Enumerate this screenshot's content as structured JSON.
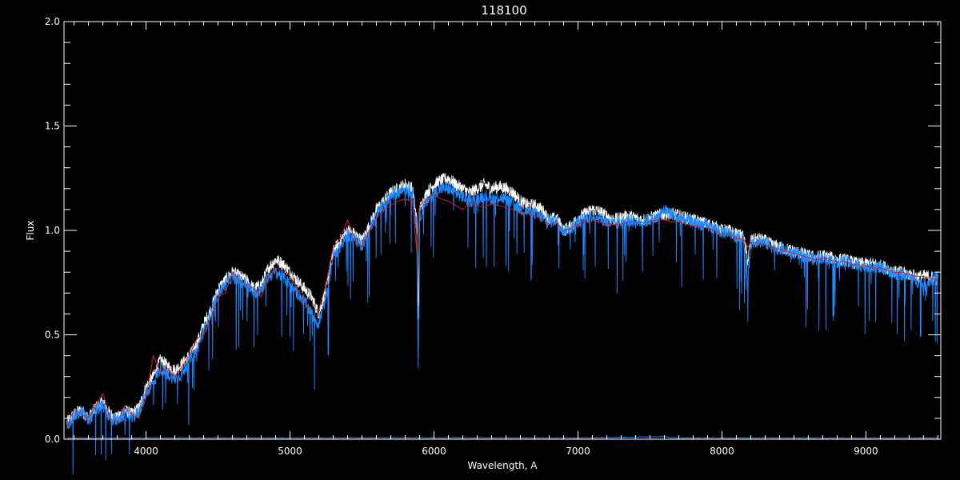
{
  "chart_data": {
    "type": "line",
    "title": "118100",
    "xlabel": "Wavelength, A",
    "ylabel": "Flux",
    "xlim": [
      3430,
      9520
    ],
    "ylim": [
      0.0,
      2.0
    ],
    "x_ticks": [
      4000,
      5000,
      6000,
      7000,
      8000,
      9000
    ],
    "x_tick_labels": [
      "4000",
      "5000",
      "6000",
      "7000",
      "8000",
      "9000"
    ],
    "y_ticks": [
      0.0,
      0.5,
      1.0,
      1.5,
      2.0
    ],
    "y_tick_labels": [
      "0.0",
      "0.5",
      "1.0",
      "1.5",
      "2.0"
    ],
    "grid": false,
    "background": "#000000",
    "series": [
      {
        "style": "white-spectrum",
        "color": "#ffffff",
        "x": [
          3450,
          3500,
          3550,
          3600,
          3650,
          3700,
          3750,
          3800,
          3850,
          3900,
          3950,
          4000,
          4050,
          4100,
          4150,
          4200,
          4250,
          4300,
          4350,
          4400,
          4450,
          4500,
          4550,
          4600,
          4650,
          4700,
          4750,
          4800,
          4850,
          4900,
          4950,
          5000,
          5050,
          5100,
          5150,
          5200,
          5250,
          5300,
          5350,
          5400,
          5450,
          5500,
          5550,
          5600,
          5650,
          5700,
          5750,
          5800,
          5850,
          5880,
          5890,
          5900,
          5950,
          6000,
          6050,
          6100,
          6150,
          6200,
          6250,
          6300,
          6350,
          6400,
          6450,
          6500,
          6550,
          6600,
          6650,
          6700,
          6750,
          6800,
          6850,
          6900,
          6950,
          7000,
          7050,
          7100,
          7150,
          7200,
          7250,
          7300,
          7350,
          7400,
          7450,
          7500,
          7550,
          7600,
          7650,
          7700,
          7750,
          7800,
          7850,
          7900,
          7950,
          8000,
          8050,
          8100,
          8150,
          8180,
          8200,
          8250,
          8300,
          8350,
          8400,
          8450,
          8500,
          8550,
          8600,
          8650,
          8700,
          8750,
          8800,
          8850,
          8900,
          8950,
          9000,
          9050,
          9100,
          9150,
          9200,
          9250,
          9300,
          9350,
          9400,
          9450,
          9500
        ],
        "y": [
          0.08,
          0.12,
          0.14,
          0.1,
          0.15,
          0.18,
          0.12,
          0.1,
          0.14,
          0.12,
          0.15,
          0.25,
          0.3,
          0.38,
          0.35,
          0.33,
          0.36,
          0.4,
          0.45,
          0.55,
          0.62,
          0.72,
          0.76,
          0.8,
          0.78,
          0.76,
          0.72,
          0.74,
          0.82,
          0.86,
          0.84,
          0.8,
          0.76,
          0.72,
          0.68,
          0.6,
          0.72,
          0.9,
          0.95,
          1.0,
          0.98,
          0.95,
          1.02,
          1.1,
          1.14,
          1.18,
          1.2,
          1.22,
          1.2,
          1.05,
          0.55,
          1.1,
          1.18,
          1.22,
          1.24,
          1.25,
          1.22,
          1.2,
          1.18,
          1.2,
          1.22,
          1.2,
          1.21,
          1.2,
          1.18,
          1.14,
          1.12,
          1.12,
          1.1,
          1.05,
          1.06,
          1.0,
          1.02,
          1.06,
          1.08,
          1.1,
          1.09,
          1.07,
          1.05,
          1.06,
          1.07,
          1.06,
          1.05,
          1.06,
          1.07,
          1.08,
          1.08,
          1.07,
          1.06,
          1.05,
          1.04,
          1.03,
          1.02,
          1.0,
          1.0,
          0.98,
          0.97,
          0.85,
          0.95,
          0.96,
          0.95,
          0.93,
          0.92,
          0.91,
          0.9,
          0.89,
          0.88,
          0.87,
          0.88,
          0.87,
          0.86,
          0.86,
          0.85,
          0.84,
          0.84,
          0.84,
          0.83,
          0.82,
          0.8,
          0.8,
          0.79,
          0.78,
          0.78,
          0.78,
          0.76
        ]
      },
      {
        "style": "blue-spectrum",
        "color": "#1e88ff",
        "x": [
          3450,
          3500,
          3550,
          3600,
          3650,
          3700,
          3750,
          3800,
          3850,
          3900,
          3950,
          4000,
          4050,
          4100,
          4150,
          4200,
          4250,
          4300,
          4350,
          4400,
          4450,
          4500,
          4550,
          4600,
          4650,
          4700,
          4750,
          4800,
          4850,
          4900,
          4950,
          5000,
          5050,
          5100,
          5150,
          5200,
          5250,
          5300,
          5350,
          5400,
          5450,
          5500,
          5550,
          5600,
          5650,
          5700,
          5750,
          5800,
          5850,
          5880,
          5890,
          5900,
          5950,
          6000,
          6050,
          6100,
          6150,
          6200,
          6250,
          6300,
          6350,
          6400,
          6450,
          6500,
          6550,
          6600,
          6650,
          6700,
          6750,
          6800,
          6850,
          6900,
          6950,
          7000,
          7050,
          7100,
          7150,
          7200,
          7250,
          7300,
          7350,
          7400,
          7450,
          7500,
          7550,
          7600,
          7650,
          7700,
          7750,
          7800,
          7850,
          7900,
          7950,
          8000,
          8050,
          8100,
          8150,
          8180,
          8200,
          8250,
          8300,
          8350,
          8400,
          8450,
          8500,
          8550,
          8600,
          8650,
          8700,
          8750,
          8800,
          8850,
          8900,
          8950,
          9000,
          9050,
          9100,
          9150,
          9200,
          9250,
          9300,
          9350,
          9400,
          9450,
          9500
        ],
        "y": [
          0.07,
          0.11,
          0.13,
          0.09,
          0.14,
          0.16,
          0.1,
          0.09,
          0.12,
          0.1,
          0.13,
          0.22,
          0.27,
          0.34,
          0.31,
          0.29,
          0.31,
          0.38,
          0.42,
          0.52,
          0.6,
          0.7,
          0.74,
          0.78,
          0.76,
          0.74,
          0.7,
          0.72,
          0.78,
          0.8,
          0.78,
          0.74,
          0.7,
          0.66,
          0.6,
          0.55,
          0.68,
          0.88,
          0.92,
          0.98,
          0.96,
          0.93,
          1.0,
          1.08,
          1.12,
          1.16,
          1.18,
          1.2,
          1.18,
          1.0,
          0.35,
          1.06,
          1.14,
          1.18,
          1.2,
          1.2,
          1.18,
          1.16,
          1.14,
          1.15,
          1.17,
          1.15,
          1.16,
          1.15,
          1.13,
          1.1,
          1.09,
          1.08,
          1.06,
          1.04,
          1.05,
          1.0,
          1.01,
          1.04,
          1.06,
          1.07,
          1.06,
          1.04,
          1.03,
          1.04,
          1.05,
          1.04,
          1.04,
          1.05,
          1.06,
          1.1,
          1.08,
          1.06,
          1.05,
          1.04,
          1.03,
          1.02,
          1.01,
          0.99,
          0.99,
          0.97,
          0.96,
          0.75,
          0.94,
          0.95,
          0.94,
          0.92,
          0.91,
          0.9,
          0.89,
          0.88,
          0.87,
          0.86,
          0.87,
          0.86,
          0.85,
          0.85,
          0.84,
          0.83,
          0.83,
          0.83,
          0.82,
          0.81,
          0.79,
          0.79,
          0.78,
          0.76,
          0.74,
          0.76,
          0.78
        ]
      },
      {
        "style": "red-model",
        "color": "#d42020",
        "x": [
          3450,
          3500,
          3550,
          3600,
          3650,
          3700,
          3750,
          3800,
          3850,
          3900,
          3950,
          4000,
          4050,
          4100,
          4150,
          4200,
          4250,
          4300,
          4350,
          4400,
          4450,
          4500,
          4550,
          4600,
          4650,
          4700,
          4750,
          4800,
          4850,
          4900,
          4950,
          5000,
          5050,
          5100,
          5150,
          5200,
          5250,
          5300,
          5350,
          5400,
          5450,
          5500,
          5550,
          5600,
          5650,
          5700,
          5750,
          5800,
          5850,
          5880,
          5890,
          5900,
          5950,
          6000,
          6050,
          6100,
          6150,
          6200,
          6250,
          6300,
          6350,
          6400,
          6450,
          6500,
          6550,
          6600,
          6650,
          6700,
          6750,
          6800,
          6850,
          6900,
          6950,
          7000,
          7050,
          7100,
          7150,
          7200,
          7250,
          7300,
          7350,
          7400,
          7450,
          7500,
          7550,
          7600,
          7650,
          7700,
          7750,
          7800,
          7850,
          7900,
          7950,
          8000,
          8050,
          8100,
          8150,
          8180,
          8200,
          8250,
          8300,
          8350,
          8400,
          8450,
          8500,
          8550,
          8600,
          8650,
          8700,
          8750,
          8800,
          8850,
          8900,
          8950,
          9000,
          9050,
          9100,
          9150,
          9200,
          9250,
          9300,
          9350,
          9400,
          9450,
          9500
        ],
        "y": [
          0.06,
          0.14,
          0.12,
          0.1,
          0.16,
          0.22,
          0.1,
          0.08,
          0.16,
          0.12,
          0.1,
          0.2,
          0.4,
          0.32,
          0.34,
          0.3,
          0.35,
          0.4,
          0.48,
          0.5,
          0.58,
          0.68,
          0.7,
          0.8,
          0.76,
          0.74,
          0.72,
          0.68,
          0.78,
          0.82,
          0.82,
          0.78,
          0.72,
          0.66,
          0.62,
          0.62,
          0.74,
          0.92,
          0.96,
          1.05,
          0.96,
          0.92,
          1.0,
          1.06,
          1.1,
          1.12,
          1.14,
          1.15,
          1.14,
          0.9,
          1.05,
          1.12,
          1.15,
          1.17,
          1.15,
          1.14,
          1.12,
          1.1,
          1.13,
          1.12,
          1.11,
          1.13,
          1.12,
          1.11,
          1.1,
          1.08,
          1.08,
          1.07,
          1.05,
          1.03,
          1.04,
          1.0,
          1.01,
          1.03,
          1.04,
          1.05,
          1.04,
          1.03,
          1.03,
          1.03,
          1.04,
          1.04,
          1.04,
          1.04,
          1.05,
          1.05,
          1.04,
          1.04,
          1.03,
          1.02,
          1.02,
          1.01,
          1.0,
          0.98,
          0.98,
          0.96,
          0.96,
          0.92,
          0.94,
          0.94,
          0.93,
          0.92,
          0.91,
          0.9,
          0.89,
          0.88,
          0.87,
          0.86,
          0.87,
          0.86,
          0.85,
          0.85,
          0.84,
          0.83,
          0.83,
          0.82,
          0.82,
          0.81,
          0.8,
          0.8,
          0.79,
          0.78,
          0.78,
          0.77,
          0.76
        ]
      },
      {
        "style": "blue-noise-baseline",
        "color": "#1e88ff",
        "x": [
          3450,
          4000,
          5000,
          6000,
          7000,
          7600,
          7650,
          7700,
          8000,
          9000,
          9500
        ],
        "y": [
          0.003,
          0.004,
          0.004,
          0.005,
          0.004,
          0.01,
          0.005,
          0.004,
          0.004,
          0.004,
          0.004
        ]
      }
    ]
  }
}
